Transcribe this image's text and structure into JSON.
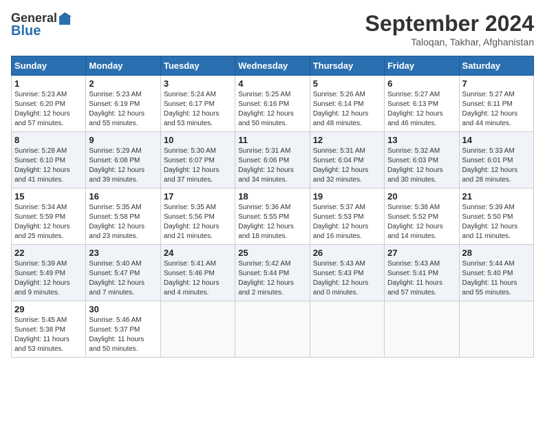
{
  "header": {
    "logo_line1": "General",
    "logo_line2": "Blue",
    "month": "September 2024",
    "location": "Taloqan, Takhar, Afghanistan"
  },
  "days_of_week": [
    "Sunday",
    "Monday",
    "Tuesday",
    "Wednesday",
    "Thursday",
    "Friday",
    "Saturday"
  ],
  "weeks": [
    [
      {
        "day": "1",
        "info": "Sunrise: 5:23 AM\nSunset: 6:20 PM\nDaylight: 12 hours\nand 57 minutes."
      },
      {
        "day": "2",
        "info": "Sunrise: 5:23 AM\nSunset: 6:19 PM\nDaylight: 12 hours\nand 55 minutes."
      },
      {
        "day": "3",
        "info": "Sunrise: 5:24 AM\nSunset: 6:17 PM\nDaylight: 12 hours\nand 53 minutes."
      },
      {
        "day": "4",
        "info": "Sunrise: 5:25 AM\nSunset: 6:16 PM\nDaylight: 12 hours\nand 50 minutes."
      },
      {
        "day": "5",
        "info": "Sunrise: 5:26 AM\nSunset: 6:14 PM\nDaylight: 12 hours\nand 48 minutes."
      },
      {
        "day": "6",
        "info": "Sunrise: 5:27 AM\nSunset: 6:13 PM\nDaylight: 12 hours\nand 46 minutes."
      },
      {
        "day": "7",
        "info": "Sunrise: 5:27 AM\nSunset: 6:11 PM\nDaylight: 12 hours\nand 44 minutes."
      }
    ],
    [
      {
        "day": "8",
        "info": "Sunrise: 5:28 AM\nSunset: 6:10 PM\nDaylight: 12 hours\nand 41 minutes."
      },
      {
        "day": "9",
        "info": "Sunrise: 5:29 AM\nSunset: 6:08 PM\nDaylight: 12 hours\nand 39 minutes."
      },
      {
        "day": "10",
        "info": "Sunrise: 5:30 AM\nSunset: 6:07 PM\nDaylight: 12 hours\nand 37 minutes."
      },
      {
        "day": "11",
        "info": "Sunrise: 5:31 AM\nSunset: 6:06 PM\nDaylight: 12 hours\nand 34 minutes."
      },
      {
        "day": "12",
        "info": "Sunrise: 5:31 AM\nSunset: 6:04 PM\nDaylight: 12 hours\nand 32 minutes."
      },
      {
        "day": "13",
        "info": "Sunrise: 5:32 AM\nSunset: 6:03 PM\nDaylight: 12 hours\nand 30 minutes."
      },
      {
        "day": "14",
        "info": "Sunrise: 5:33 AM\nSunset: 6:01 PM\nDaylight: 12 hours\nand 28 minutes."
      }
    ],
    [
      {
        "day": "15",
        "info": "Sunrise: 5:34 AM\nSunset: 5:59 PM\nDaylight: 12 hours\nand 25 minutes."
      },
      {
        "day": "16",
        "info": "Sunrise: 5:35 AM\nSunset: 5:58 PM\nDaylight: 12 hours\nand 23 minutes."
      },
      {
        "day": "17",
        "info": "Sunrise: 5:35 AM\nSunset: 5:56 PM\nDaylight: 12 hours\nand 21 minutes."
      },
      {
        "day": "18",
        "info": "Sunrise: 5:36 AM\nSunset: 5:55 PM\nDaylight: 12 hours\nand 18 minutes."
      },
      {
        "day": "19",
        "info": "Sunrise: 5:37 AM\nSunset: 5:53 PM\nDaylight: 12 hours\nand 16 minutes."
      },
      {
        "day": "20",
        "info": "Sunrise: 5:38 AM\nSunset: 5:52 PM\nDaylight: 12 hours\nand 14 minutes."
      },
      {
        "day": "21",
        "info": "Sunrise: 5:39 AM\nSunset: 5:50 PM\nDaylight: 12 hours\nand 11 minutes."
      }
    ],
    [
      {
        "day": "22",
        "info": "Sunrise: 5:39 AM\nSunset: 5:49 PM\nDaylight: 12 hours\nand 9 minutes."
      },
      {
        "day": "23",
        "info": "Sunrise: 5:40 AM\nSunset: 5:47 PM\nDaylight: 12 hours\nand 7 minutes."
      },
      {
        "day": "24",
        "info": "Sunrise: 5:41 AM\nSunset: 5:46 PM\nDaylight: 12 hours\nand 4 minutes."
      },
      {
        "day": "25",
        "info": "Sunrise: 5:42 AM\nSunset: 5:44 PM\nDaylight: 12 hours\nand 2 minutes."
      },
      {
        "day": "26",
        "info": "Sunrise: 5:43 AM\nSunset: 5:43 PM\nDaylight: 12 hours\nand 0 minutes."
      },
      {
        "day": "27",
        "info": "Sunrise: 5:43 AM\nSunset: 5:41 PM\nDaylight: 11 hours\nand 57 minutes."
      },
      {
        "day": "28",
        "info": "Sunrise: 5:44 AM\nSunset: 5:40 PM\nDaylight: 11 hours\nand 55 minutes."
      }
    ],
    [
      {
        "day": "29",
        "info": "Sunrise: 5:45 AM\nSunset: 5:38 PM\nDaylight: 11 hours\nand 53 minutes."
      },
      {
        "day": "30",
        "info": "Sunrise: 5:46 AM\nSunset: 5:37 PM\nDaylight: 11 hours\nand 50 minutes."
      },
      {
        "day": "",
        "info": ""
      },
      {
        "day": "",
        "info": ""
      },
      {
        "day": "",
        "info": ""
      },
      {
        "day": "",
        "info": ""
      },
      {
        "day": "",
        "info": ""
      }
    ]
  ]
}
